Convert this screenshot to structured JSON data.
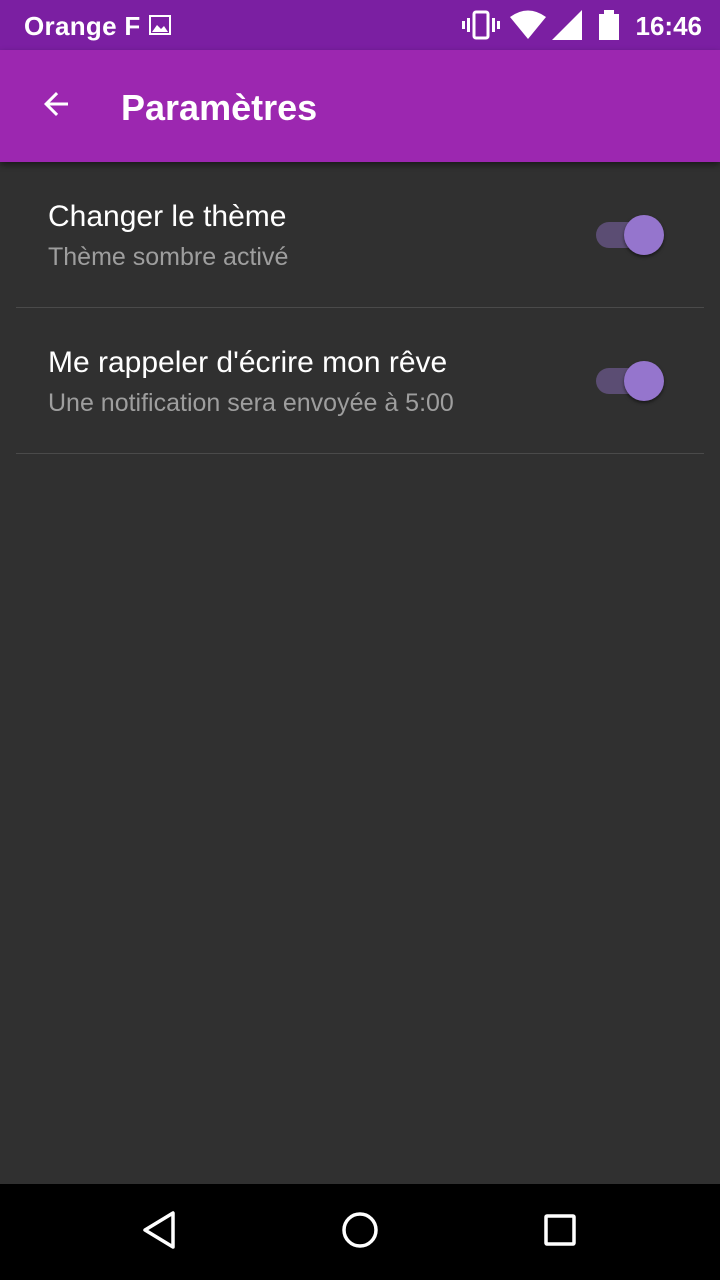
{
  "status_bar": {
    "carrier": "Orange F",
    "time": "16:46",
    "icons": [
      "image-icon",
      "vibrate-icon",
      "wifi-icon",
      "signal-icon",
      "battery-icon"
    ]
  },
  "app_bar": {
    "title": "Paramètres",
    "back_icon": "arrow-back-icon",
    "background": "#9c27b0"
  },
  "preferences": [
    {
      "title": "Changer le thème",
      "summary": "Thème sombre activé",
      "enabled": true
    },
    {
      "title": "Me rappeler d'écrire mon rêve",
      "summary": "Une notification sera envoyée à 5:00",
      "enabled": true
    }
  ],
  "nav_bar": {
    "icons": [
      "back-triangle-icon",
      "home-circle-icon",
      "recents-square-icon"
    ]
  },
  "colors": {
    "status_bar": "#7b1fa2",
    "background": "#303030",
    "switch_thumb": "#9575cd",
    "switch_track": "#5b4d73"
  }
}
